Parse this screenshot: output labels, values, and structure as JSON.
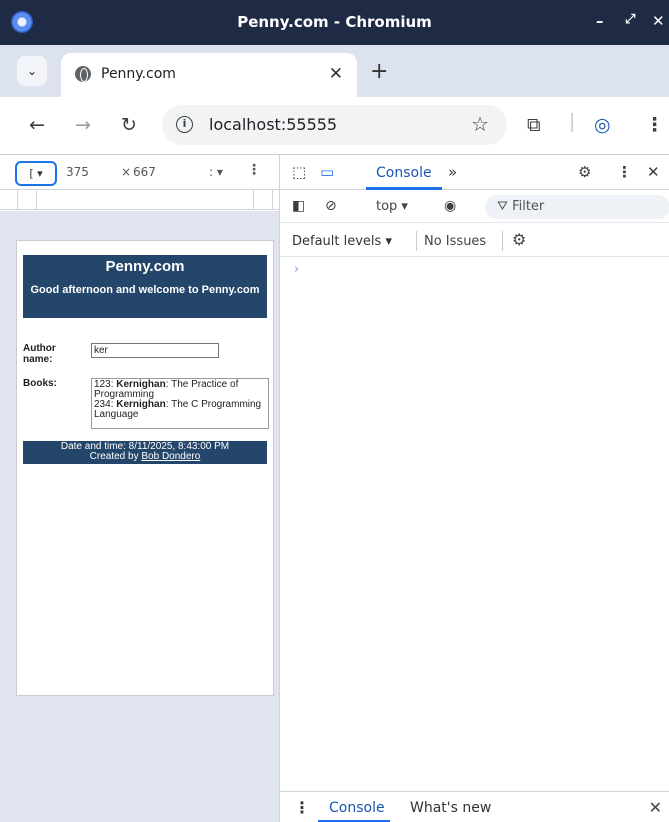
{
  "window": {
    "title": "Penny.com - Chromium",
    "minimize_icon": "minimize-icon",
    "maximize_icon": "maximize-icon",
    "close_icon": "close-icon"
  },
  "tabs": [
    {
      "label": "Penny.com",
      "active": true
    }
  ],
  "toolbar": {
    "url": "localhost:55555"
  },
  "device_toolbar": {
    "width": "375",
    "times": "×",
    "height": "667"
  },
  "page": {
    "heading": "Penny.com",
    "greeting": "Good afternoon and welcome to Penny.com",
    "author_label": "Author name:",
    "author_value": "ker",
    "books_label": "Books:",
    "books": [
      {
        "isbn": "123",
        "author": "Kernighan",
        "title": "The Practice of Programming"
      },
      {
        "isbn": "234",
        "author": "Kernighan",
        "title": "The C Programming Language"
      }
    ],
    "datetime": "Date and time: 8/11/2025, 8:43:00 PM",
    "created_by_prefix": "Created by",
    "creator": "Bob Dondero"
  },
  "devtools": {
    "active_tab": "Console",
    "more_tabs": "»",
    "context": "top ▾",
    "filter_placeholder": "Filter",
    "levels": "Default levels ▾",
    "issues": "No Issues",
    "prompt": "›",
    "drawer_tabs": [
      "Console",
      "What's new"
    ]
  },
  "colors": {
    "titlebar": "#1f2a44",
    "penny_blue": "#25466b",
    "accent": "#1a73e8"
  }
}
